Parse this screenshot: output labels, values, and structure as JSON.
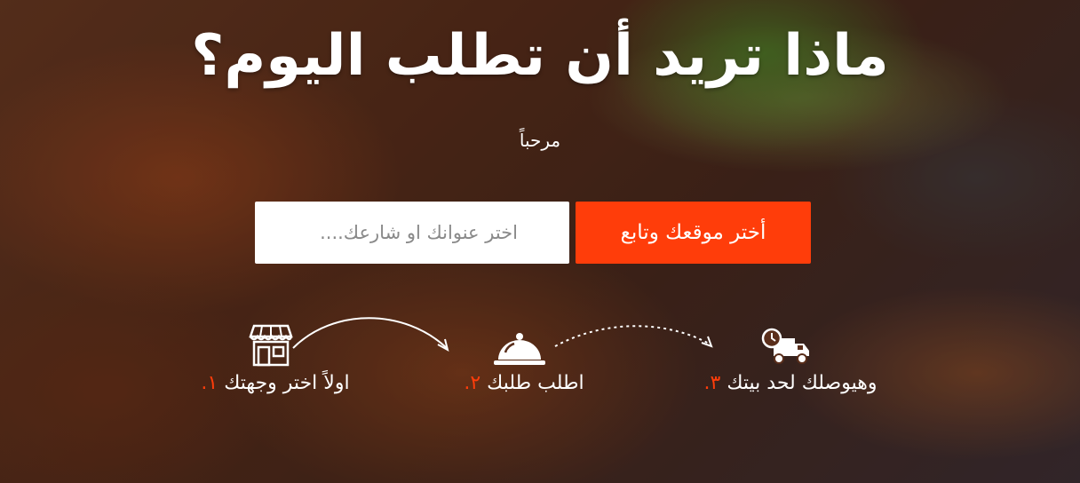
{
  "hero": {
    "title": "ماذا تريد أن تطلب اليوم؟",
    "subtitle": "مرحباً"
  },
  "search": {
    "placeholder": "اختر عنوانك او شارعك....",
    "button_label": "أختر موقعك وتابع"
  },
  "steps": [
    {
      "number": "١.",
      "label": "اولاً اختر وجهتك",
      "icon": "store-icon"
    },
    {
      "number": "٢.",
      "label": "اطلب طلبك",
      "icon": "food-cloche-icon"
    },
    {
      "number": "٣.",
      "label": "وهيوصلك لحد بيتك",
      "icon": "delivery-truck-icon"
    }
  ],
  "colors": {
    "accent": "#ff3d0a",
    "text": "#ffffff"
  }
}
